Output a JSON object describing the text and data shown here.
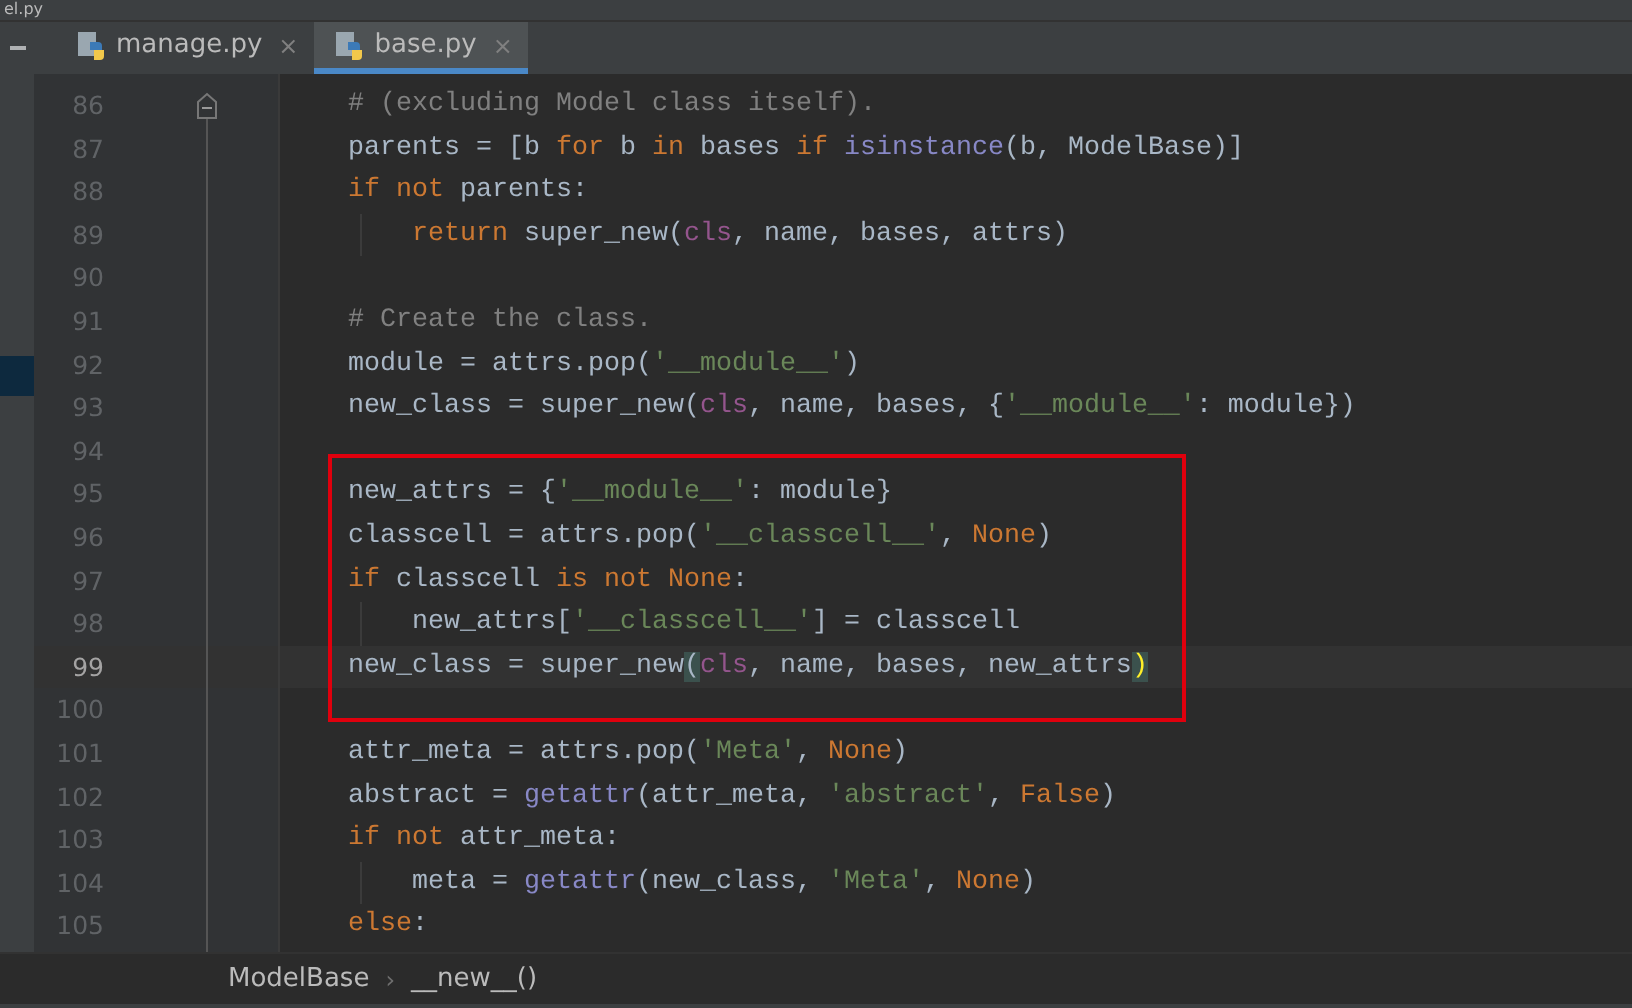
{
  "window": {
    "title": "el.py"
  },
  "tabs": [
    {
      "label": "manage.py",
      "selected": false,
      "close": "×"
    },
    {
      "label": "base.py",
      "selected": true,
      "close": "×"
    }
  ],
  "editor": {
    "blocks": [
      {
        "lines": [
          {
            "number": "86",
            "tokens": [
              {
                "text": "# (excluding Model class itself).",
                "kind": "comment"
              }
            ]
          },
          {
            "number": "87",
            "tokens": [
              {
                "text": "parents = [b ",
                "kind": "plain"
              },
              {
                "text": "for",
                "kind": "keyword"
              },
              {
                "text": " b ",
                "kind": "plain"
              },
              {
                "text": "in",
                "kind": "keyword"
              },
              {
                "text": " bases ",
                "kind": "plain"
              },
              {
                "text": "if",
                "kind": "keyword"
              },
              {
                "text": " isinstance",
                "kind": "builtin"
              },
              {
                "text": "(b, ModelBase)]",
                "kind": "plain"
              }
            ]
          },
          {
            "number": "88",
            "tokens": [
              {
                "text": "if",
                "kind": "keyword"
              },
              {
                "text": " not",
                "kind": "keyword"
              },
              {
                "text": " parents:",
                "kind": "plain"
              }
            ]
          },
          {
            "number": "89",
            "indented": true,
            "tokens": [
              {
                "text": "return",
                "kind": "keyword"
              },
              {
                "text": " super_new(",
                "kind": "plain"
              },
              {
                "text": "cls",
                "kind": "param"
              },
              {
                "text": ", name, bases, attrs)",
                "kind": "plain"
              }
            ]
          },
          {
            "number": "90"
          },
          {
            "number": "91",
            "tokens": [
              {
                "text": "# Create the class.",
                "kind": "comment"
              }
            ]
          },
          {
            "number": "92",
            "tokens": [
              {
                "text": "module = attrs.pop(",
                "kind": "plain"
              },
              {
                "text": "'__module__'",
                "kind": "string"
              },
              {
                "text": ")",
                "kind": "plain"
              }
            ]
          },
          {
            "number": "93",
            "tokens": [
              {
                "text": "new_class = super_new(",
                "kind": "plain"
              },
              {
                "text": "cls",
                "kind": "param"
              },
              {
                "text": ", name, bases, {",
                "kind": "plain"
              },
              {
                "text": "'__module__'",
                "kind": "string"
              },
              {
                "text": ": module})",
                "kind": "plain"
              }
            ]
          },
          {
            "number": "94"
          }
        ]
      },
      {
        "boxed": true,
        "lines": [
          {
            "number": "95",
            "tokens": [
              {
                "text": "new_attrs = {",
                "kind": "plain"
              },
              {
                "text": "'__module__'",
                "kind": "string"
              },
              {
                "text": ": module}",
                "kind": "plain"
              }
            ]
          },
          {
            "number": "96",
            "tokens": [
              {
                "text": "classcell = attrs.pop(",
                "kind": "plain"
              },
              {
                "text": "'__classcell__'",
                "kind": "string"
              },
              {
                "text": ", ",
                "kind": "plain"
              },
              {
                "text": "None",
                "kind": "keyword"
              },
              {
                "text": ")",
                "kind": "plain"
              }
            ]
          },
          {
            "number": "97",
            "tokens": [
              {
                "text": "if",
                "kind": "keyword"
              },
              {
                "text": " classcell ",
                "kind": "plain"
              },
              {
                "text": "is not",
                "kind": "keyword"
              },
              {
                "text": " None",
                "kind": "keyword"
              },
              {
                "text": ":",
                "kind": "plain"
              }
            ]
          },
          {
            "number": "98",
            "indented": true,
            "tokens": [
              {
                "text": "new_attrs[",
                "kind": "plain"
              },
              {
                "text": "'__classcell__'",
                "kind": "string"
              },
              {
                "text": "] = classcell",
                "kind": "plain"
              }
            ]
          },
          {
            "number": "99",
            "current": true,
            "tokens": [
              {
                "text": "new_class = super_new",
                "kind": "plain"
              },
              {
                "text": "(",
                "kind": "brace-open"
              },
              {
                "text": "cls",
                "kind": "param"
              },
              {
                "text": ", name, bases, new_attrs",
                "kind": "plain"
              },
              {
                "text": ")",
                "kind": "brace-close"
              }
            ]
          },
          {
            "number": "100"
          }
        ]
      },
      {
        "lines": [
          {
            "number": "101",
            "tokens": [
              {
                "text": "attr_meta = attrs.pop(",
                "kind": "plain"
              },
              {
                "text": "'Meta'",
                "kind": "string"
              },
              {
                "text": ", ",
                "kind": "plain"
              },
              {
                "text": "None",
                "kind": "keyword"
              },
              {
                "text": ")",
                "kind": "plain"
              }
            ]
          },
          {
            "number": "102",
            "tokens": [
              {
                "text": "abstract = ",
                "kind": "plain"
              },
              {
                "text": "getattr",
                "kind": "builtin"
              },
              {
                "text": "(attr_meta, ",
                "kind": "plain"
              },
              {
                "text": "'abstract'",
                "kind": "string"
              },
              {
                "text": ", ",
                "kind": "plain"
              },
              {
                "text": "False",
                "kind": "keyword"
              },
              {
                "text": ")",
                "kind": "plain"
              }
            ]
          },
          {
            "number": "103",
            "tokens": [
              {
                "text": "if",
                "kind": "keyword"
              },
              {
                "text": " not",
                "kind": "keyword"
              },
              {
                "text": " attr_meta:",
                "kind": "plain"
              }
            ]
          },
          {
            "number": "104",
            "indented": true,
            "tokens": [
              {
                "text": "meta = ",
                "kind": "plain"
              },
              {
                "text": "getattr",
                "kind": "builtin"
              },
              {
                "text": "(new_class, ",
                "kind": "plain"
              },
              {
                "text": "'Meta'",
                "kind": "string"
              },
              {
                "text": ", ",
                "kind": "plain"
              },
              {
                "text": "None",
                "kind": "keyword"
              },
              {
                "text": ")",
                "kind": "plain"
              }
            ]
          },
          {
            "number": "105",
            "tokens": [
              {
                "text": "else",
                "kind": "keyword"
              },
              {
                "text": ":",
                "kind": "plain"
              }
            ]
          }
        ]
      }
    ]
  },
  "breadcrumb": {
    "items": [
      "ModelBase",
      "__new__()"
    ],
    "separator": "›"
  }
}
